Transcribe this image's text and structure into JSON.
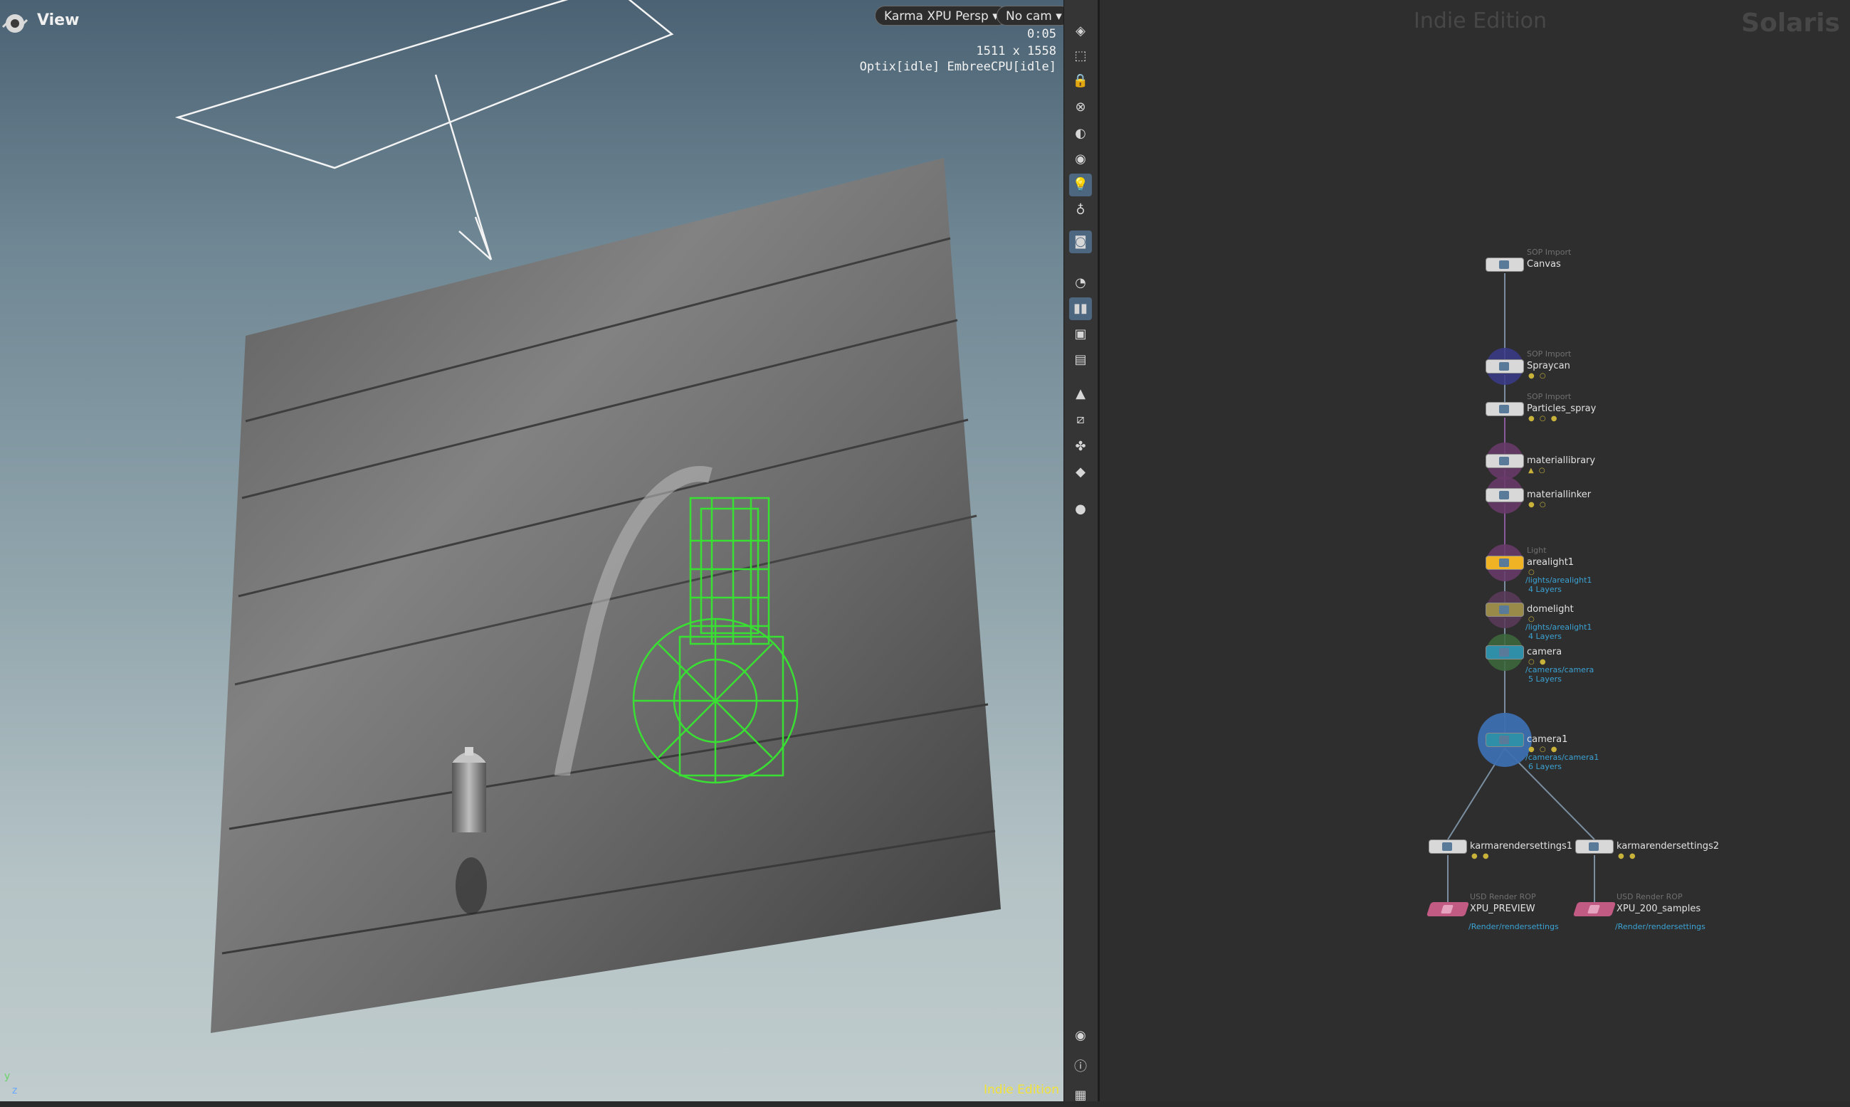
{
  "viewport": {
    "title": "View",
    "renderer_menu": "Karma XPU  Persp",
    "camera_menu": "No cam",
    "stats": {
      "time": "0:05",
      "resolution": "1511 x 1558",
      "engines": "Optix[idle] EmbreeCPU[idle]"
    },
    "edition_label": "Indie Edition",
    "axis": {
      "y": "y",
      "z": "z"
    },
    "colors": {
      "selection_wireframe": "#39e033",
      "edition_label": "#f2e23a",
      "sky_top": "#4a6273",
      "sky_bottom": "#c0cccd"
    }
  },
  "toolbar": {
    "items": [
      {
        "name": "display-options-icon",
        "active": false
      },
      {
        "name": "view-options-icon",
        "active": false
      },
      {
        "name": "lock-camera-icon",
        "active": false
      },
      {
        "name": "close-camera-icon",
        "active": false
      },
      {
        "name": "shading-mode-icon",
        "active": false
      },
      {
        "name": "headlight-icon",
        "active": false
      },
      {
        "name": "scene-lights-icon",
        "active": true
      },
      {
        "name": "light-mode-icon",
        "active": false
      },
      {
        "name": "render-camera-icon",
        "active": true
      },
      {
        "name": "visibility-eye-icon",
        "active": false
      },
      {
        "name": "pause-render-icon",
        "active": true
      },
      {
        "name": "snapshot-icon",
        "active": false
      },
      {
        "name": "render-region-icon",
        "active": false
      },
      {
        "name": "color-correction-icon",
        "active": false
      },
      {
        "name": "geometry-select-icon",
        "active": false
      },
      {
        "name": "instance-select-icon",
        "active": false
      },
      {
        "name": "primitive-select-icon",
        "active": false
      },
      {
        "name": "background-sphere-icon",
        "active": false
      },
      {
        "name": "viewport-eye-icon",
        "active": false
      },
      {
        "name": "info-icon",
        "active": false
      },
      {
        "name": "layout-grid-icon",
        "active": false
      }
    ]
  },
  "network": {
    "edition_label": "Indie Edition",
    "context_label": "Solaris",
    "nodes": [
      {
        "id": "canvas",
        "type": "SOP Import",
        "name": "Canvas",
        "path": "",
        "layers": "",
        "flags": ""
      },
      {
        "id": "spraycan",
        "type": "SOP Import",
        "name": "Spraycan",
        "path": "",
        "layers": "",
        "flags": "● ○"
      },
      {
        "id": "particles",
        "type": "SOP Import",
        "name": "Particles_spray",
        "path": "",
        "layers": "",
        "flags": "● ○ ●"
      },
      {
        "id": "materiallibrary",
        "type": "",
        "name": "materiallibrary",
        "path": "",
        "layers": "",
        "flags": "▲ ○"
      },
      {
        "id": "materiallinker",
        "type": "",
        "name": "materiallinker",
        "path": "",
        "layers": "",
        "flags": "● ○"
      },
      {
        "id": "arealight1",
        "type": "Light",
        "name": "arealight1",
        "path": "/lights/arealight1",
        "layers": "4 Layers",
        "flags": "○"
      },
      {
        "id": "domelight",
        "type": "",
        "name": "domelight",
        "path": "/lights/arealight1",
        "layers": "4 Layers",
        "flags": "○"
      },
      {
        "id": "camera",
        "type": "",
        "name": "camera",
        "path": "/cameras/camera",
        "layers": "5 Layers",
        "flags": "○ ●"
      },
      {
        "id": "camera1",
        "type": "",
        "name": "camera1",
        "path": "/cameras/camera1",
        "layers": "6 Layers",
        "flags": "● ○ ●"
      },
      {
        "id": "krs1",
        "type": "",
        "name": "karmarendersettings1",
        "path": "",
        "layers": "",
        "flags": "● ●"
      },
      {
        "id": "krs2",
        "type": "",
        "name": "karmarendersettings2",
        "path": "",
        "layers": "",
        "flags": "● ●"
      },
      {
        "id": "rop1",
        "type": "USD Render ROP",
        "name": "XPU_PREVIEW",
        "path": "/Render/rendersettings",
        "layers": "",
        "flags": ""
      },
      {
        "id": "rop2",
        "type": "USD Render ROP",
        "name": "XPU_200_samples",
        "path": "/Render/rendersettings",
        "layers": "",
        "flags": ""
      }
    ],
    "colors": {
      "wire": "#7a8ea0",
      "path_text": "#3ba3d4",
      "camera_node": "#2f8fa8",
      "rop_node": "#c25b84",
      "selected_ring": "#3d6fb0"
    }
  }
}
